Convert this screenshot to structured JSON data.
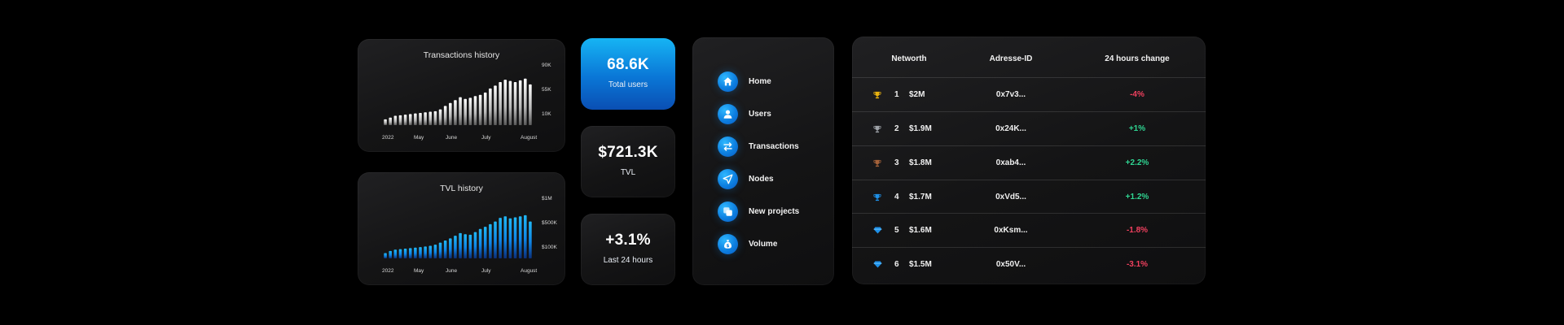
{
  "colors": {
    "accent": "#0f86e6",
    "accent_light": "#21b7f5",
    "positive": "#2fd693",
    "negative": "#f0405e",
    "gold": "#e8b10f",
    "silver": "#9ea2a8",
    "bronze": "#a5623a",
    "gem": "#1e90e8"
  },
  "transactions_chart": {
    "title": "Transactions history",
    "x_labels": [
      "2022",
      "May",
      "June",
      "July",
      "August"
    ],
    "y_labels": [
      "90K",
      "55K",
      "10K"
    ]
  },
  "tvl_chart": {
    "title": "TVL history",
    "x_labels": [
      "2022",
      "May",
      "June",
      "July",
      "August"
    ],
    "y_labels": [
      "$1M",
      "$500K",
      "$100K"
    ]
  },
  "chart_data": [
    {
      "type": "bar",
      "title": "Transactions history",
      "categories": [
        "2022",
        "May",
        "June",
        "July",
        "August"
      ],
      "yticks": [
        "10K",
        "55K",
        "90K"
      ],
      "ylim": [
        0,
        95
      ],
      "values": [
        10,
        13,
        16,
        17,
        18,
        19,
        20,
        21,
        22,
        23,
        24,
        27,
        33,
        38,
        43,
        48,
        45,
        47,
        50,
        52,
        56,
        63,
        68,
        74,
        78,
        76,
        74,
        77,
        80,
        70
      ],
      "grid": false
    },
    {
      "type": "bar",
      "title": "TVL history",
      "categories": [
        "2022",
        "May",
        "June",
        "July",
        "August"
      ],
      "yticks": [
        "$100K",
        "$500K",
        "$1M"
      ],
      "ylim": [
        0,
        1050
      ],
      "values": [
        100,
        140,
        165,
        175,
        185,
        195,
        205,
        215,
        225,
        240,
        260,
        300,
        340,
        380,
        430,
        480,
        460,
        450,
        500,
        560,
        600,
        650,
        700,
        770,
        800,
        760,
        780,
        800,
        820,
        700
      ],
      "grid": false
    }
  ],
  "stats": [
    {
      "value": "68.6K",
      "label": "Total users"
    },
    {
      "value": "$721.3K",
      "label": "TVL"
    },
    {
      "value": "+3.1%",
      "label": "Last 24 hours"
    }
  ],
  "menu": {
    "items": [
      {
        "label": "Home",
        "icon": "home-icon"
      },
      {
        "label": "Users",
        "icon": "user-icon"
      },
      {
        "label": "Transactions",
        "icon": "transfer-arrows-icon"
      },
      {
        "label": "Nodes",
        "icon": "send-arrow-icon"
      },
      {
        "label": "New projects",
        "icon": "copy-icon"
      },
      {
        "label": "Volume",
        "icon": "money-bag-icon"
      }
    ]
  },
  "table": {
    "headers": {
      "networth": "Networth",
      "address": "Adresse-ID",
      "change": "24 hours change"
    },
    "rows": [
      {
        "icon": "gold-trophy-icon",
        "rank": "1",
        "networth": "$2M",
        "address": "0x7v3...",
        "change": "-4%",
        "positive": false
      },
      {
        "icon": "silver-trophy-icon",
        "rank": "2",
        "networth": "$1.9M",
        "address": "0x24K...",
        "change": "+1%",
        "positive": true
      },
      {
        "icon": "bronze-trophy-icon",
        "rank": "3",
        "networth": "$1.8M",
        "address": "0xab4...",
        "change": "+2.2%",
        "positive": true
      },
      {
        "icon": "blue-trophy-icon",
        "rank": "4",
        "networth": "$1.7M",
        "address": "0xVd5...",
        "change": "+1.2%",
        "positive": true
      },
      {
        "icon": "gem-icon",
        "rank": "5",
        "networth": "$1.6M",
        "address": "0xKsm...",
        "change": "-1.8%",
        "positive": false
      },
      {
        "icon": "gem-icon",
        "rank": "6",
        "networth": "$1.5M",
        "address": "0x50V...",
        "change": "-3.1%",
        "positive": false
      }
    ]
  }
}
